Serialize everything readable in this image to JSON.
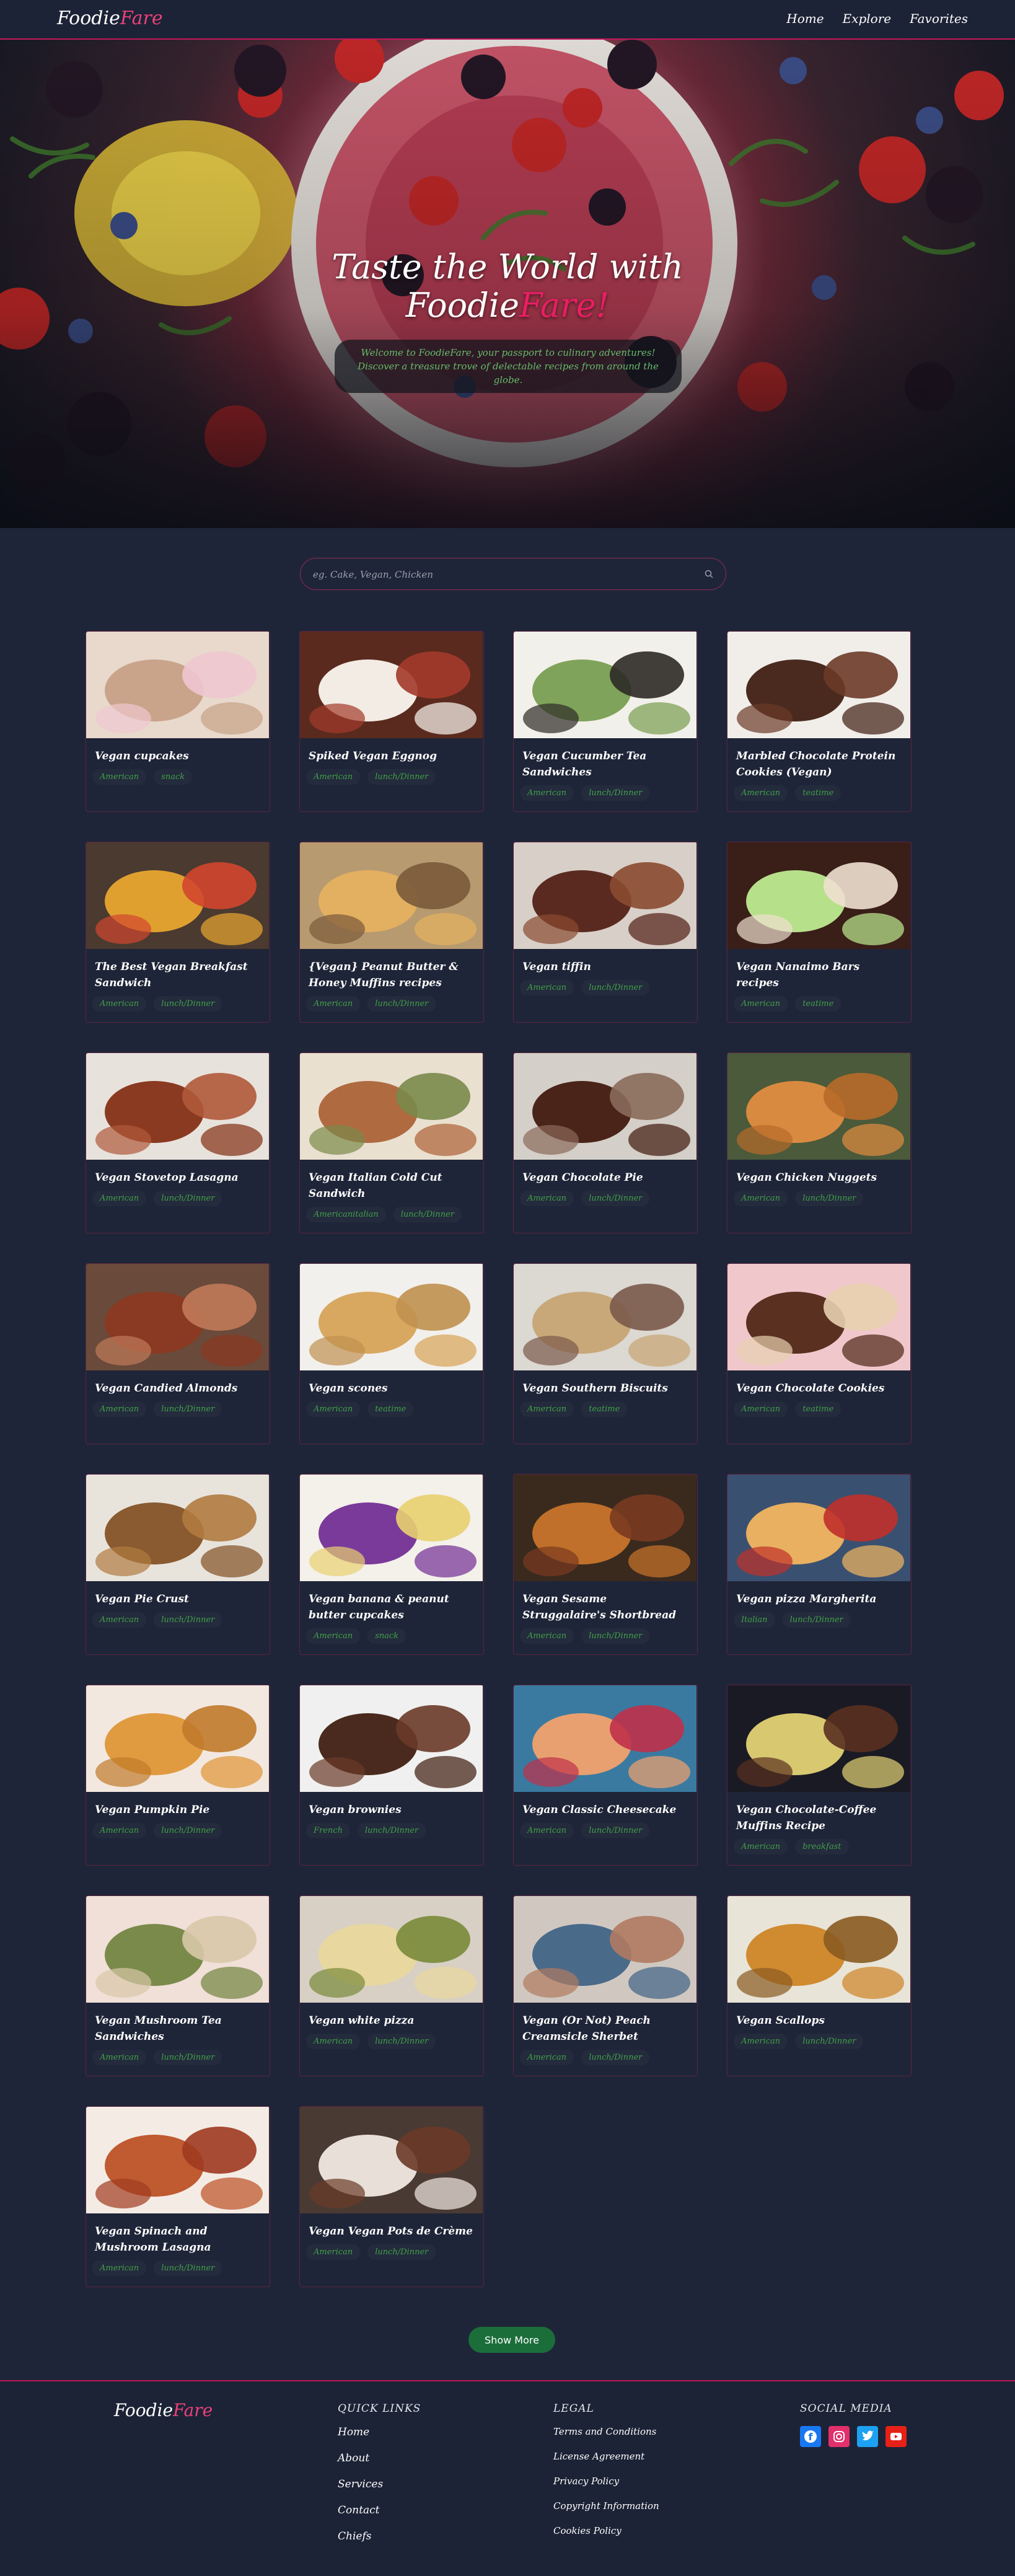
{
  "nav": {
    "logo_a": "Foodie",
    "logo_b": "Fare",
    "links": [
      "Home",
      "Explore",
      "Favorites"
    ]
  },
  "hero": {
    "title_line1": "Taste the World with",
    "title_a": "Foodie",
    "title_b": "Fare!",
    "subtitle_line1": "Welcome to FoodieFare, your passport to culinary adventures!",
    "subtitle_line2": "Discover a treasure trove of delectable recipes from around the globe."
  },
  "search": {
    "placeholder": "eg. Cake, Vegan, Chicken",
    "icon": "search-icon"
  },
  "recipes": [
    {
      "title": "Vegan cupcakes",
      "tags": [
        "American",
        "snack"
      ]
    },
    {
      "title": "Spiked Vegan Eggnog",
      "tags": [
        "American",
        "lunch/Dinner"
      ]
    },
    {
      "title": "Vegan Cucumber Tea Sandwiches",
      "tags": [
        "American",
        "lunch/Dinner"
      ]
    },
    {
      "title": "Marbled Chocolate Protein Cookies (Vegan)",
      "tags": [
        "American",
        "teatime"
      ]
    },
    {
      "title": "The Best Vegan Breakfast Sandwich",
      "tags": [
        "American",
        "lunch/Dinner"
      ]
    },
    {
      "title": "{Vegan} Peanut Butter & Honey Muffins recipes",
      "tags": [
        "American",
        "lunch/Dinner"
      ]
    },
    {
      "title": "Vegan tiffin",
      "tags": [
        "American",
        "lunch/Dinner"
      ]
    },
    {
      "title": "Vegan Nanaimo Bars recipes",
      "tags": [
        "American",
        "teatime"
      ]
    },
    {
      "title": "Vegan Stovetop Lasagna",
      "tags": [
        "American",
        "lunch/Dinner"
      ]
    },
    {
      "title": "Vegan Italian Cold Cut Sandwich",
      "tags": [
        "Americanitalian",
        "lunch/Dinner"
      ]
    },
    {
      "title": "Vegan Chocolate Pie",
      "tags": [
        "American",
        "lunch/Dinner"
      ]
    },
    {
      "title": "Vegan Chicken Nuggets",
      "tags": [
        "American",
        "lunch/Dinner"
      ]
    },
    {
      "title": "Vegan Candied Almonds",
      "tags": [
        "American",
        "lunch/Dinner"
      ]
    },
    {
      "title": "Vegan scones",
      "tags": [
        "American",
        "teatime"
      ]
    },
    {
      "title": "Vegan Southern Biscuits",
      "tags": [
        "American",
        "teatime"
      ]
    },
    {
      "title": "Vegan Chocolate Cookies",
      "tags": [
        "American",
        "teatime"
      ]
    },
    {
      "title": "Vegan Pie Crust",
      "tags": [
        "American",
        "lunch/Dinner"
      ]
    },
    {
      "title": "Vegan banana & peanut butter cupcakes",
      "tags": [
        "American",
        "snack"
      ]
    },
    {
      "title": "Vegan Sesame Struggalaire's Shortbread",
      "tags": [
        "American",
        "lunch/Dinner"
      ]
    },
    {
      "title": "Vegan pizza Margherita",
      "tags": [
        "Italian",
        "lunch/Dinner"
      ]
    },
    {
      "title": "Vegan Pumpkin Pie",
      "tags": [
        "American",
        "lunch/Dinner"
      ]
    },
    {
      "title": "Vegan brownies",
      "tags": [
        "French",
        "lunch/Dinner"
      ]
    },
    {
      "title": "Vegan Classic Cheesecake",
      "tags": [
        "American",
        "lunch/Dinner"
      ]
    },
    {
      "title": "Vegan Chocolate-Coffee Muffins Recipe",
      "tags": [
        "American",
        "breakfast"
      ]
    },
    {
      "title": "Vegan Mushroom Tea Sandwiches",
      "tags": [
        "American",
        "lunch/Dinner"
      ]
    },
    {
      "title": "Vegan white pizza",
      "tags": [
        "American",
        "lunch/Dinner"
      ]
    },
    {
      "title": "Vegan (Or Not) Peach Creamsicle Sherbet",
      "tags": [
        "American",
        "lunch/Dinner"
      ]
    },
    {
      "title": "Vegan Scallops",
      "tags": [
        "American",
        "lunch/Dinner"
      ]
    },
    {
      "title": "Vegan Spinach and Mushroom Lasagna",
      "tags": [
        "American",
        "lunch/Dinner"
      ]
    },
    {
      "title": "Vegan Vegan Pots de Crème",
      "tags": [
        "American",
        "lunch/Dinner"
      ]
    }
  ],
  "show_more": "Show More",
  "footer": {
    "logo_a": "Foodie",
    "logo_b": "Fare",
    "quick_links_title": "QUICK LINKS",
    "quick_links": [
      "Home",
      "About",
      "Services",
      "Contact",
      "Chiefs"
    ],
    "legal_title": "LEGAL",
    "legal": [
      "Terms and Conditions",
      "License Agreement",
      "Privacy Policy",
      "Copyright Information",
      "Cookies Policy"
    ],
    "social_title": "SOCIAL MEDIA",
    "social": [
      {
        "icon": "facebook-icon",
        "color": "#1877f2"
      },
      {
        "icon": "instagram-icon",
        "color": "#e1306c"
      },
      {
        "icon": "twitter-icon",
        "color": "#1da1f2"
      },
      {
        "icon": "youtube-icon",
        "color": "#e62117"
      }
    ]
  },
  "colors": {
    "background": "#1f2538",
    "accent_pink": "#e91e63",
    "tag_green": "#43a047",
    "button_green": "#1b6e3a"
  }
}
